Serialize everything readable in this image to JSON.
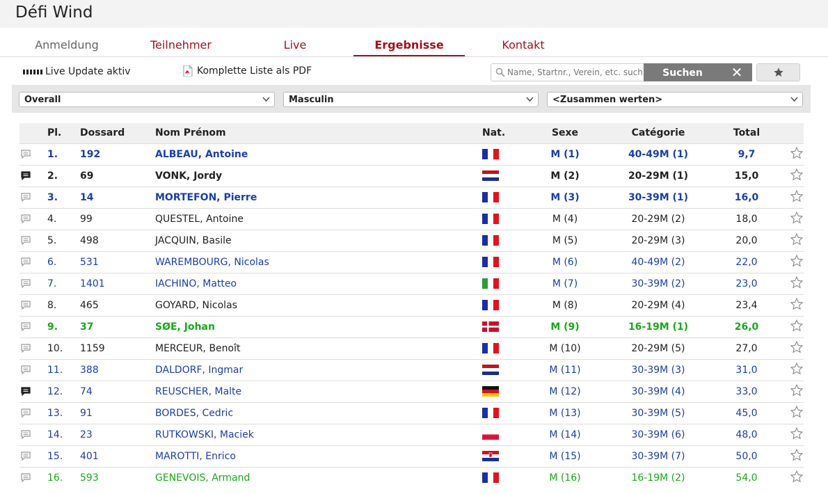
{
  "app": {
    "title": "Défi Wind"
  },
  "nav": {
    "tabs": [
      {
        "label": "Anmeldung",
        "style": "gray"
      },
      {
        "label": "Teilnehmer",
        "style": "red"
      },
      {
        "label": "Live",
        "style": "red"
      },
      {
        "label": "Ergebnisse",
        "style": "active"
      },
      {
        "label": "Kontakt",
        "style": "red"
      }
    ]
  },
  "toolbar": {
    "live_label": "Live Update aktiv",
    "pdf_label": "Komplette Liste als PDF",
    "search_placeholder": "Name, Startnr., Verein, etc. suchen",
    "search_button": "Suchen",
    "clear_button": "✕",
    "favorite_icon": "star-icon"
  },
  "filters": {
    "contest": "Overall",
    "gender": "Masculin",
    "grouping": "<Zusammen werten>"
  },
  "table": {
    "headers": {
      "place": "Pl.",
      "bib": "Dossard",
      "name": "Nom Prénom",
      "nat": "Nat.",
      "sex": "Sexe",
      "cat": "Catégorie",
      "total": "Total"
    },
    "colors": {
      "blue": "#1a3fa8",
      "green": "#1aa81a",
      "black": "#222222"
    },
    "rows": [
      {
        "place": "1.",
        "bib": "192",
        "name": "ALBEAU, Antoine",
        "flag": "FR",
        "sex": "M (1)",
        "cat": "40-49M (1)",
        "total": "9,7",
        "color": "blue",
        "bold": true,
        "comment": "light"
      },
      {
        "place": "2.",
        "bib": "69",
        "name": "VONK, Jordy",
        "flag": "NL",
        "sex": "M (2)",
        "cat": "20-29M (1)",
        "total": "15,0",
        "color": "black",
        "bold": true,
        "comment": "dark"
      },
      {
        "place": "3.",
        "bib": "14",
        "name": "MORTEFON, Pierre",
        "flag": "FR",
        "sex": "M (3)",
        "cat": "30-39M (1)",
        "total": "16,0",
        "color": "blue",
        "bold": true,
        "comment": "light"
      },
      {
        "place": "4.",
        "bib": "99",
        "name": "QUESTEL, Antoine",
        "flag": "FR",
        "sex": "M (4)",
        "cat": "20-29M (2)",
        "total": "18,0",
        "color": "black",
        "bold": false,
        "comment": "light"
      },
      {
        "place": "5.",
        "bib": "498",
        "name": "JACQUIN, Basile",
        "flag": "FR",
        "sex": "M (5)",
        "cat": "20-29M (3)",
        "total": "20,0",
        "color": "black",
        "bold": false,
        "comment": "light"
      },
      {
        "place": "6.",
        "bib": "531",
        "name": "WAREMBOURG, Nicolas",
        "flag": "FR",
        "sex": "M (6)",
        "cat": "40-49M (2)",
        "total": "22,0",
        "color": "blue",
        "bold": false,
        "comment": "light"
      },
      {
        "place": "7.",
        "bib": "1401",
        "name": "IACHINO, Matteo",
        "flag": "IT",
        "sex": "M (7)",
        "cat": "30-39M (2)",
        "total": "23,0",
        "color": "blue",
        "bold": false,
        "comment": "light"
      },
      {
        "place": "8.",
        "bib": "465",
        "name": "GOYARD, Nicolas",
        "flag": "FR",
        "sex": "M (8)",
        "cat": "20-29M (4)",
        "total": "23,4",
        "color": "black",
        "bold": false,
        "comment": "light"
      },
      {
        "place": "9.",
        "bib": "37",
        "name": "SØE, Johan",
        "flag": "DK",
        "sex": "M (9)",
        "cat": "16-19M (1)",
        "total": "26,0",
        "color": "green",
        "bold": true,
        "comment": "light"
      },
      {
        "place": "10.",
        "bib": "1159",
        "name": "MERCEUR, Benoît",
        "flag": "FR",
        "sex": "M (10)",
        "cat": "20-29M (5)",
        "total": "27,0",
        "color": "black",
        "bold": false,
        "comment": "light"
      },
      {
        "place": "11.",
        "bib": "388",
        "name": "DALDORF, Ingmar",
        "flag": "NL",
        "sex": "M (11)",
        "cat": "30-39M (3)",
        "total": "31,0",
        "color": "blue",
        "bold": false,
        "comment": "light"
      },
      {
        "place": "12.",
        "bib": "74",
        "name": "REUSCHER, Malte",
        "flag": "DE",
        "sex": "M (12)",
        "cat": "30-39M (4)",
        "total": "33,0",
        "color": "blue",
        "bold": false,
        "comment": "dark"
      },
      {
        "place": "13.",
        "bib": "91",
        "name": "BORDES, Cedric",
        "flag": "FR",
        "sex": "M (13)",
        "cat": "30-39M (5)",
        "total": "45,0",
        "color": "blue",
        "bold": false,
        "comment": "light"
      },
      {
        "place": "14.",
        "bib": "23",
        "name": "RUTKOWSKI, Maciek",
        "flag": "PL",
        "sex": "M (14)",
        "cat": "30-39M (6)",
        "total": "48,0",
        "color": "blue",
        "bold": false,
        "comment": "light"
      },
      {
        "place": "15.",
        "bib": "401",
        "name": "MAROTTI, Enrico",
        "flag": "HR",
        "sex": "M (15)",
        "cat": "30-39M (7)",
        "total": "50,0",
        "color": "blue",
        "bold": false,
        "comment": "light"
      },
      {
        "place": "16.",
        "bib": "593",
        "name": "GENEVOIS, Armand",
        "flag": "FR",
        "sex": "M (16)",
        "cat": "16-19M (2)",
        "total": "54,0",
        "color": "green",
        "bold": false,
        "comment": "light"
      }
    ]
  }
}
